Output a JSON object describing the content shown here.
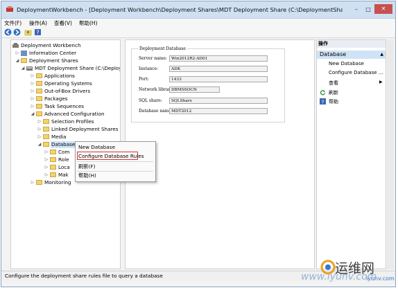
{
  "window": {
    "title": "DeploymentWorkbench - [Deployment Workbench\\Deployment Shares\\MDT Deployment Share (C:\\DeploymentShare)\\...",
    "min": "–",
    "max": "□",
    "close": "✕"
  },
  "menu": [
    "文件(F)",
    "操作(A)",
    "查看(V)",
    "帮助(H)"
  ],
  "tree": {
    "root": "Deployment Workbench",
    "information_center": "Information Center",
    "deployment_shares": "Deployment Shares",
    "share": "MDT Deployment Share (C:\\Deployme",
    "applications": "Applications",
    "operating_systems": "Operating Systems",
    "oob_drivers": "Out-of-Box Drivers",
    "packages": "Packages",
    "task_sequences": "Task Sequences",
    "advanced_configuration": "Advanced Configuration",
    "selection_profiles": "Selection Profiles",
    "linked_shares": "Linked Deployment Shares",
    "media": "Media",
    "database": "Database",
    "sub1": "Com",
    "sub2": "Role",
    "sub3": "Loca",
    "sub4": "Mak",
    "monitoring": "Monitoring"
  },
  "details": {
    "group_title": "Deployment Database",
    "fields": [
      {
        "label": "Server name:",
        "value": "Win2012R2-AD01"
      },
      {
        "label": "Instance:",
        "value": "ADK"
      },
      {
        "label": "Port:",
        "value": "1433"
      },
      {
        "label": "Network librar",
        "value": "DBMSSOCN"
      },
      {
        "label": "SQL share:",
        "value": "SQLShare"
      },
      {
        "label": "Database name:",
        "value": "MDT2012"
      }
    ]
  },
  "actions": {
    "header": "操作",
    "section": "Database",
    "items": [
      "New Database",
      "Configure Database ...",
      "查看",
      "刷新",
      "帮助"
    ]
  },
  "context_menu": {
    "new_database": "New Database",
    "configure_rules": "Configure Database Rules",
    "refresh": "刷新(F)",
    "help": "帮助(H)"
  },
  "status": "Configure the deployment share rules file to query a database",
  "watermark": {
    "main": "运维网",
    "sub": "www.iyunv.com",
    "domain": "iyunv.com"
  },
  "colors": {
    "titlebar": "#cfe0f2",
    "selection": "#cfe3f7",
    "highlight_border": "#e03030",
    "folder": "#f4d36b"
  }
}
